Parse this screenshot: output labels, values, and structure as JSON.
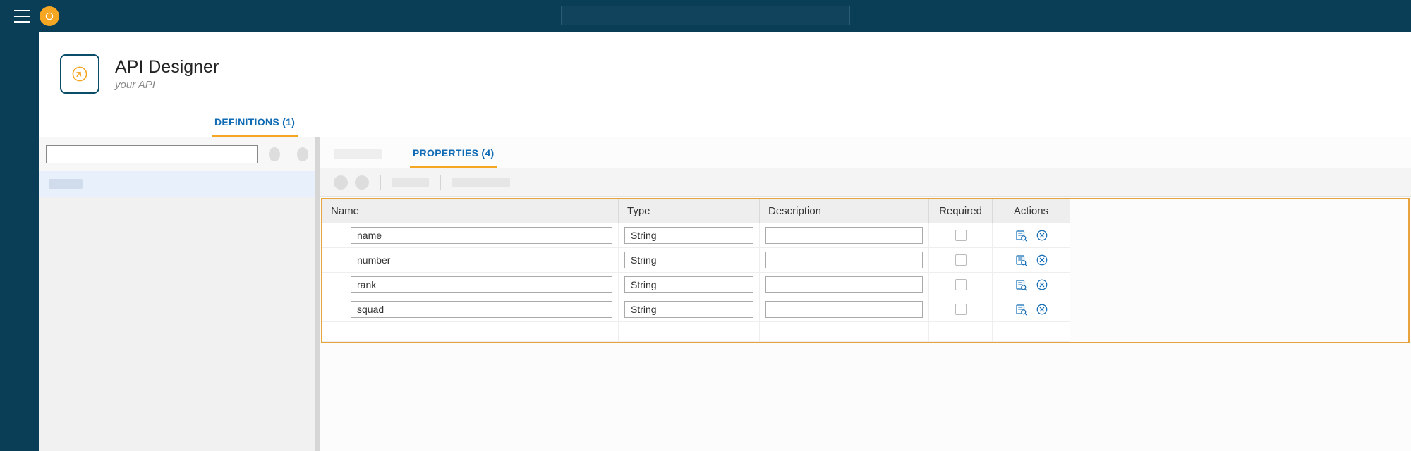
{
  "header": {
    "title": "API Designer",
    "subtitle": "your API"
  },
  "tabs": {
    "definitions": "DEFINITIONS (1)",
    "properties": "PROPERTIES (4)"
  },
  "table": {
    "headers": {
      "name": "Name",
      "type": "Type",
      "description": "Description",
      "required": "Required",
      "actions": "Actions"
    },
    "rows": [
      {
        "name": "name",
        "type": "String",
        "description": ""
      },
      {
        "name": "number",
        "type": "String",
        "description": ""
      },
      {
        "name": "rank",
        "type": "String",
        "description": ""
      },
      {
        "name": "squad",
        "type": "String",
        "description": ""
      }
    ]
  }
}
